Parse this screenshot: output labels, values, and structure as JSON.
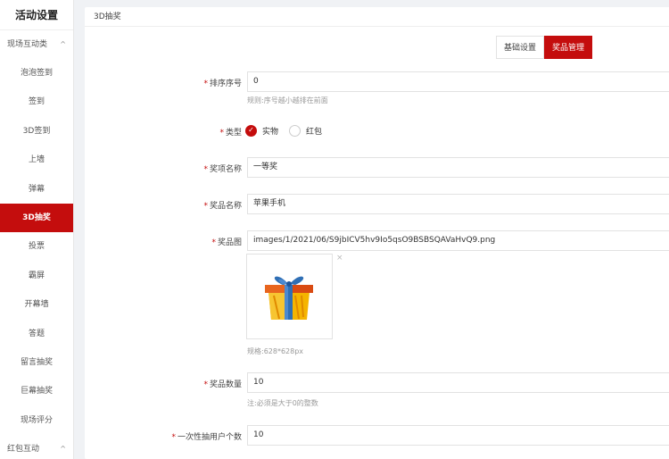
{
  "sidebar": {
    "title": "活动设置",
    "group1": {
      "label": "现场互动类",
      "chevron": "^"
    },
    "items": [
      "泡泡签到",
      "签到",
      "3D签到",
      "上墙",
      "弹幕",
      "3D抽奖",
      "投票",
      "霸屏",
      "开幕墙",
      "答题",
      "留言抽奖",
      "巨幕抽奖",
      "现场评分"
    ],
    "active_index": 5,
    "group2": {
      "label": "红包互动",
      "chevron": "^"
    }
  },
  "panel": {
    "title": "3D抽奖",
    "tabs": [
      "基础设置",
      "奖品管理"
    ],
    "active_tab": 1
  },
  "form": {
    "required_mark": "*",
    "sort": {
      "label": "排序序号",
      "value": "0",
      "hint": "规则:序号越小越排在前面"
    },
    "type": {
      "label": "类型",
      "options": [
        "实物",
        "红包"
      ],
      "selected": 0,
      "check_glyph": "✓"
    },
    "item_name": {
      "label": "奖项名称",
      "value": "一等奖"
    },
    "prize_name": {
      "label": "奖品名称",
      "value": "苹果手机"
    },
    "prize_image": {
      "label": "奖品图",
      "value": "images/1/2021/06/S9jbICV5hv9Io5qsO9BSBSQAVaHvQ9.png",
      "hint": "规格:628*628px",
      "close_glyph": "×",
      "icon": "gift-icon"
    },
    "prize_count": {
      "label": "奖品数量",
      "value": "10",
      "hint": "注:必须是大于0的整数"
    },
    "draw_count": {
      "label": "一次性抽用户个数",
      "value": "10"
    }
  },
  "colors": {
    "accent": "#c40d0d",
    "ribbon": "#2f6fb5",
    "gift_yellow": "#f5b400"
  }
}
